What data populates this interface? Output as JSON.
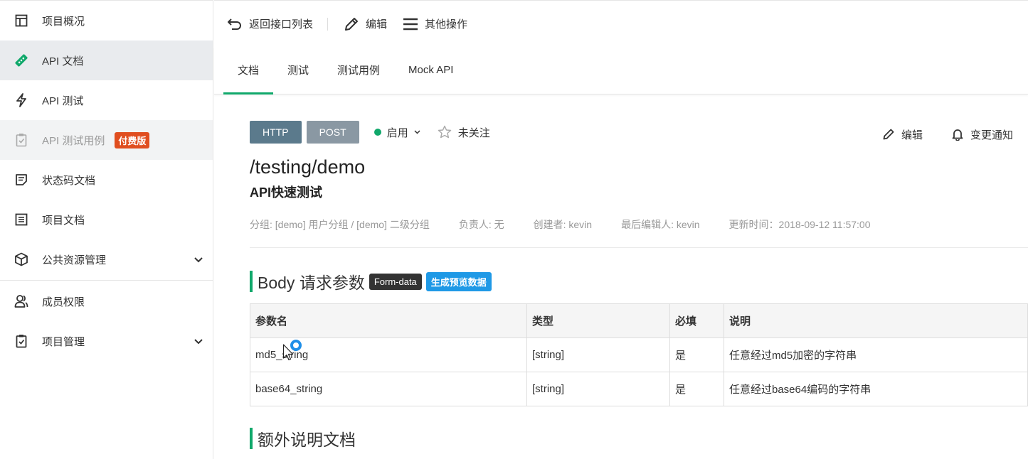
{
  "sidebar": {
    "items": [
      {
        "label": "项目概况",
        "icon": "dashboard-icon"
      },
      {
        "label": "API 文档",
        "icon": "api-doc-icon"
      },
      {
        "label": "API 测试",
        "icon": "lightning-icon"
      },
      {
        "label": "API 测试用例",
        "icon": "clipboard-check-icon",
        "badge": "付费版"
      },
      {
        "label": "状态码文档",
        "icon": "note-icon"
      },
      {
        "label": "项目文档",
        "icon": "document-icon"
      },
      {
        "label": "公共资源管理",
        "icon": "cube-icon"
      },
      {
        "label": "成员权限",
        "icon": "users-icon"
      },
      {
        "label": "项目管理",
        "icon": "clipboard-icon"
      }
    ]
  },
  "toolbar": {
    "back_label": "返回接口列表",
    "edit_label": "编辑",
    "more_label": "其他操作"
  },
  "tabs": [
    "文档",
    "测试",
    "测试用例",
    "Mock API"
  ],
  "api": {
    "protocol": "HTTP",
    "method": "POST",
    "status": "启用",
    "follow": "未关注",
    "edit": "编辑",
    "notify": "变更通知",
    "path": "/testing/demo",
    "name": "API快速测试",
    "info": {
      "group": "分组: [demo] 用户分组 / [demo] 二级分组",
      "owner": "负责人: 无",
      "creator": "创建者: kevin",
      "last_editor": "最后编辑人: kevin",
      "updated": "更新时间：2018-09-12 11:57:00"
    }
  },
  "body_params": {
    "title": "Body 请求参数",
    "format_tag": "Form-data",
    "generate_tag": "生成预览数据",
    "headers": [
      "参数名",
      "类型",
      "必填",
      "说明"
    ],
    "rows": [
      [
        "md5_string",
        "[string]",
        "是",
        "任意经过md5加密的字符串"
      ],
      [
        "base64_string",
        "[string]",
        "是",
        "任意经过base64编码的字符串"
      ]
    ]
  },
  "extra_doc": {
    "title": "额外说明文档"
  },
  "colors": {
    "accent": "#10a86b",
    "badge": "#e04e1f",
    "http_tag": "#5b7a8c",
    "post_tag": "#8a98a3",
    "blue_tag": "#1f99e6"
  }
}
